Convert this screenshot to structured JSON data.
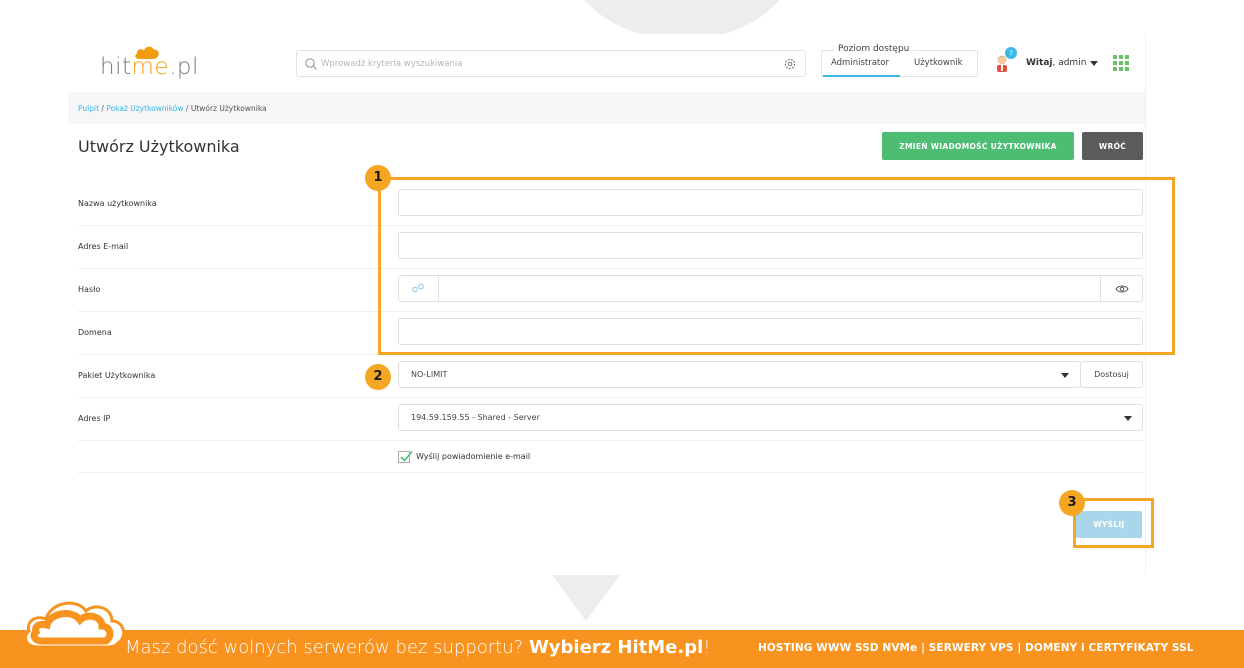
{
  "brand": {
    "logo_prefix": "hit",
    "logo_accent": "me",
    "logo_suffix": ".pl",
    "accent_color": "#f39c12"
  },
  "search": {
    "placeholder": "Wprowadź kryteria wyszukiwania",
    "value": ""
  },
  "access": {
    "title": "Poziom dostępu",
    "tabs": [
      "Administrator",
      "Użytkownik"
    ],
    "active": "Administrator"
  },
  "user": {
    "notifications": "7",
    "greeting": "Witaj",
    "name": ", admin"
  },
  "breadcrumb": {
    "items": [
      "Pulpit",
      "Pokaż Użytkowników",
      "Utwórz Użytkownika"
    ],
    "separator": " / "
  },
  "page": {
    "title": "Utwórz Użytkownika",
    "buttons": {
      "change_message": "ZMIEŃ WIADOMOŚĆ UŻYTKOWNIKA",
      "back": "WRÓĆ"
    }
  },
  "form": {
    "username": {
      "label": "Nazwa użytkownika",
      "value": ""
    },
    "email": {
      "label": "Adres E-mail",
      "value": ""
    },
    "password": {
      "label": "Hasło",
      "value": ""
    },
    "domain": {
      "label": "Domena",
      "value": ""
    },
    "package": {
      "label": "Pakiet Użytkownika",
      "value": "NO-LIMIT",
      "adjust_label": "Dostosuj"
    },
    "ip": {
      "label": "Adres IP",
      "value": "194.59.159.55 - Shared - Server"
    },
    "notify": {
      "label": "Wyślij powiadomienie e-mail",
      "checked": true
    },
    "submit_label": "WYŚLIJ"
  },
  "annotations": {
    "badge_1": "1",
    "badge_2": "2",
    "badge_3": "3",
    "color": "#f5a623"
  },
  "banner": {
    "text_prefix": "Masz dość wolnych serwerów bez supportu? ",
    "text_bold": "Wybierz HitMe.pl",
    "text_suffix": "!",
    "right_text": "HOSTING WWW SSD NVMe | SERWERY VPS | DOMENY i CERTYFIKATY SSL",
    "color": "#f7931e"
  }
}
